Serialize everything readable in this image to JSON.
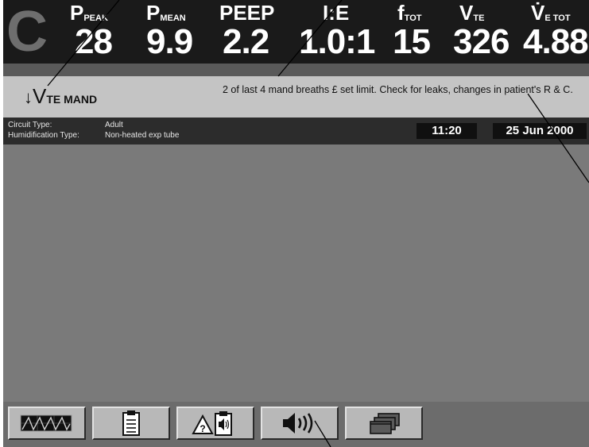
{
  "mode_logo": "C",
  "parameters": [
    {
      "label": "P",
      "sub": "PEAK",
      "value": "28"
    },
    {
      "label": "P",
      "sub": "MEAN",
      "value": "9.9"
    },
    {
      "label": "PEEP",
      "sub": "",
      "value": "2.2"
    },
    {
      "label": "I:E",
      "sub": "",
      "value": "1.0:1"
    },
    {
      "label": "f",
      "sub": "TOT",
      "value": "15"
    },
    {
      "label": "V",
      "sub": "TE",
      "value": "326"
    },
    {
      "label": "V̇",
      "sub": "E TOT",
      "value": "4.88"
    }
  ],
  "alarm": {
    "arrow": "↓",
    "name_main": "V",
    "name_sub": "TE MAND",
    "message": "2 of last 4 mand breaths £ set limit. Check for leaks, changes in patient's R & C."
  },
  "info": {
    "circuit_label": "Circuit Type:",
    "circuit_value": "Adult",
    "humidification_label": "Humidification Type:",
    "humidification_value": "Non-heated exp tube"
  },
  "clock": {
    "time": "11:20",
    "date": "25 Jun 2000"
  },
  "tabs": [
    {
      "icon": "waveform-icon"
    },
    {
      "icon": "clipboard-icon"
    },
    {
      "icon": "alarm-log-icon"
    },
    {
      "icon": "speaker-icon"
    },
    {
      "icon": "stacked-windows-icon"
    }
  ],
  "colors": {
    "top_bar": "#1a1a1a",
    "alarm_panel": "#c4c4c4",
    "info_strip": "#2c2c2c",
    "screen_bg": "#7a7a7a",
    "button_face": "#b8b8b8"
  }
}
